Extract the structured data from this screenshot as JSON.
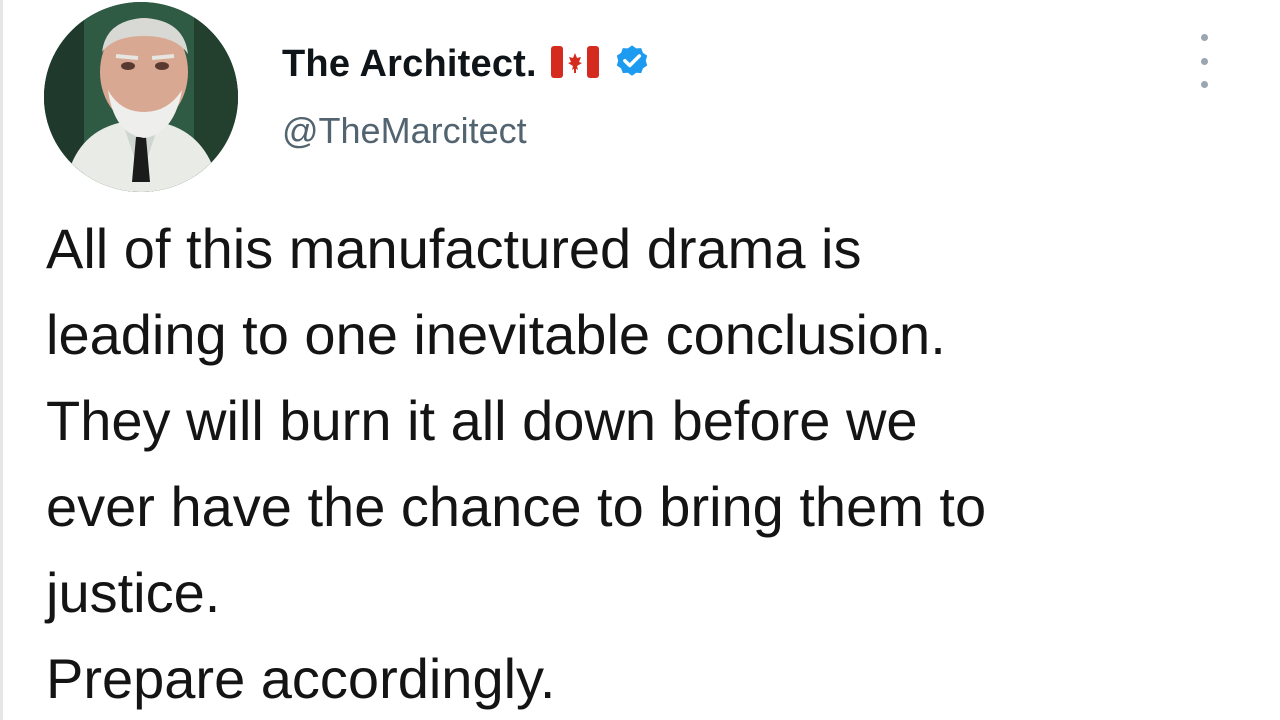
{
  "tweet": {
    "author": {
      "display_name": "The Architect.",
      "handle": "@TheMarcitect",
      "avatar_icon": "profile-photo-icon",
      "flag_icon": "canada-flag-icon",
      "verified_icon": "verified-badge-icon"
    },
    "menu_icon": "more-options-icon",
    "text_lines": [
      "All of this manufactured drama is",
      "leading to one inevitable conclusion.",
      "They will burn it all down before we",
      "ever have the chance to bring them to",
      "justice.",
      "Prepare accordingly."
    ]
  },
  "colors": {
    "background": "#ffffff",
    "text": "#141414",
    "handle": "#536471",
    "verified": "#1d9bf0",
    "flag_red": "#d52b1e"
  }
}
